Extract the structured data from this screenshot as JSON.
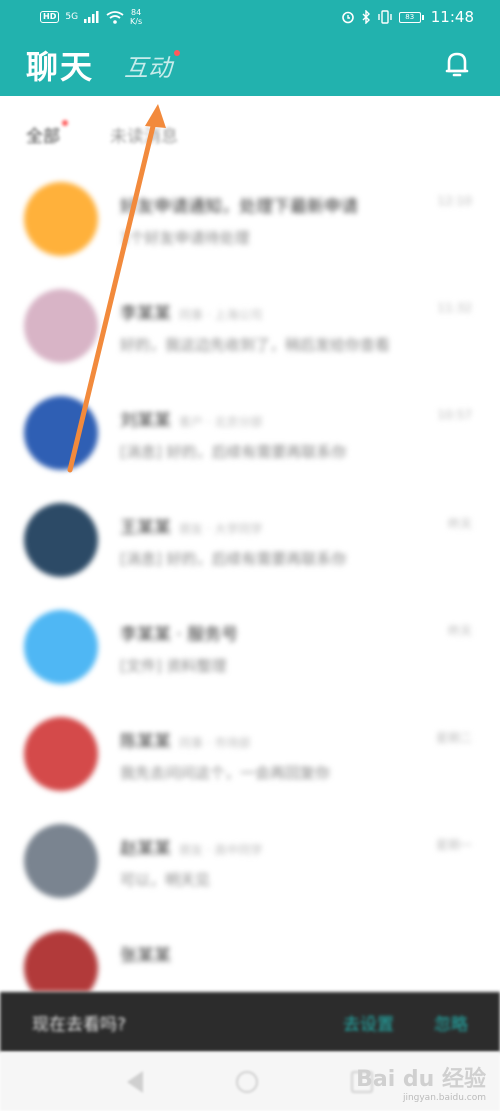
{
  "status_bar": {
    "hd": "HD",
    "network": "5G",
    "speed_value": "84",
    "speed_unit": "K/s",
    "battery": "83",
    "time": "11:48"
  },
  "header": {
    "tab_chat": "聊天",
    "tab_interact": "互动"
  },
  "filters": {
    "all": "全部",
    "unread": "未读消息"
  },
  "chats": [
    {
      "avatar_color": "#ffb13b",
      "name": "好友申请通知，处理下最新申请",
      "sub": "",
      "preview": "1个好友申请待处理",
      "time": "12:10"
    },
    {
      "avatar_color": "#d8b4c6",
      "name": "李某某",
      "sub": "同事 · 上海公司",
      "preview": "好的，我这边先收到了，稍后发给你查看",
      "time": "11:32"
    },
    {
      "avatar_color": "#2f5fb4",
      "name": "刘某某",
      "sub": "客户 · 北京分部",
      "preview": "[消息] 好的，后续有需要再联系你",
      "time": "10:57"
    },
    {
      "avatar_color": "#2c4a66",
      "name": "王某某",
      "sub": "朋友 · 大学同学",
      "preview": "[消息] 好的，后续有需要再联系你",
      "time": "昨天"
    },
    {
      "avatar_color": "#4fb7f4",
      "name": "李某某 · 服务号",
      "sub": "",
      "preview": "[文件] 资料整理",
      "time": "昨天"
    },
    {
      "avatar_color": "#d44a4a",
      "name": "陈某某",
      "sub": "同事 · 市场部",
      "preview": "我先去问问这个，一会再回复你",
      "time": "星期二"
    },
    {
      "avatar_color": "#7a8490",
      "name": "赵某某",
      "sub": "朋友 · 高中同学",
      "preview": "可以，明天见",
      "time": "星期一"
    },
    {
      "avatar_color": "#b23a3a",
      "name": "张某某",
      "sub": "",
      "preview": "",
      "time": ""
    }
  ],
  "snackbar": {
    "text": "现在去看吗?",
    "action_primary": "去设置",
    "action_secondary": "忽略"
  },
  "watermark": {
    "logo": "Bai du 经验",
    "url": "jingyan.baidu.com"
  },
  "colors": {
    "brand": "#22b2ae",
    "arrow": "#f28a3c",
    "badge": "#ff5a5a"
  }
}
